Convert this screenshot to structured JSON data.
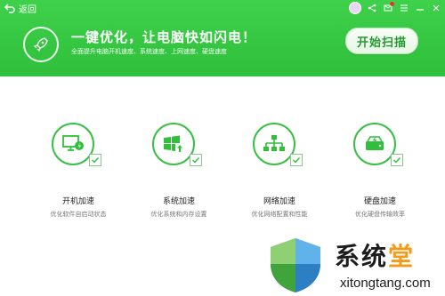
{
  "titlebar": {
    "back_label": "返回"
  },
  "hero": {
    "title": "一键优化，让电脑快如闪电！",
    "subtitle": "全面提升电脑开机速度、系统速度、上网速度、硬盘速度",
    "scan_label": "开始扫描"
  },
  "features": [
    {
      "title": "开机加速",
      "desc": "优化软件自启动状态",
      "icon": "monitor-bolt-icon"
    },
    {
      "title": "系统加速",
      "desc": "优化系统和内存设置",
      "icon": "windows-up-icon"
    },
    {
      "title": "网络加速",
      "desc": "优化网络配置和性能",
      "icon": "network-icon"
    },
    {
      "title": "硬盘加速",
      "desc": "优化硬盘传输效率",
      "icon": "hdd-bolt-icon"
    }
  ],
  "watermark": {
    "brand_main": "系统",
    "brand_accent": "堂",
    "url": "xitongtang.com"
  },
  "colors": {
    "accent": "#3fd14b",
    "button_text": "#249a2f"
  }
}
